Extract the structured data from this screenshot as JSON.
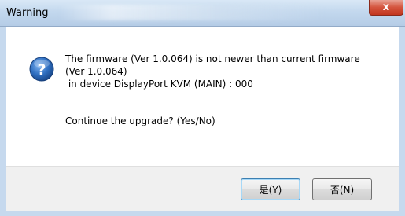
{
  "window": {
    "title": "Warning",
    "close_symbol": "x"
  },
  "message": {
    "line1": "The firmware (Ver 1.0.064) is not newer than current firmware",
    "line2": "(Ver 1.0.064)",
    "line3": " in device DisplayPort KVM (MAIN) : 000",
    "question": "Continue the upgrade? (Yes/No)",
    "icon": "question-icon"
  },
  "buttons": {
    "yes_label": "是(Y)",
    "no_label": "否(N)"
  },
  "colors": {
    "icon_blue": "#2f6fc1",
    "close_red": "#c9402a"
  }
}
